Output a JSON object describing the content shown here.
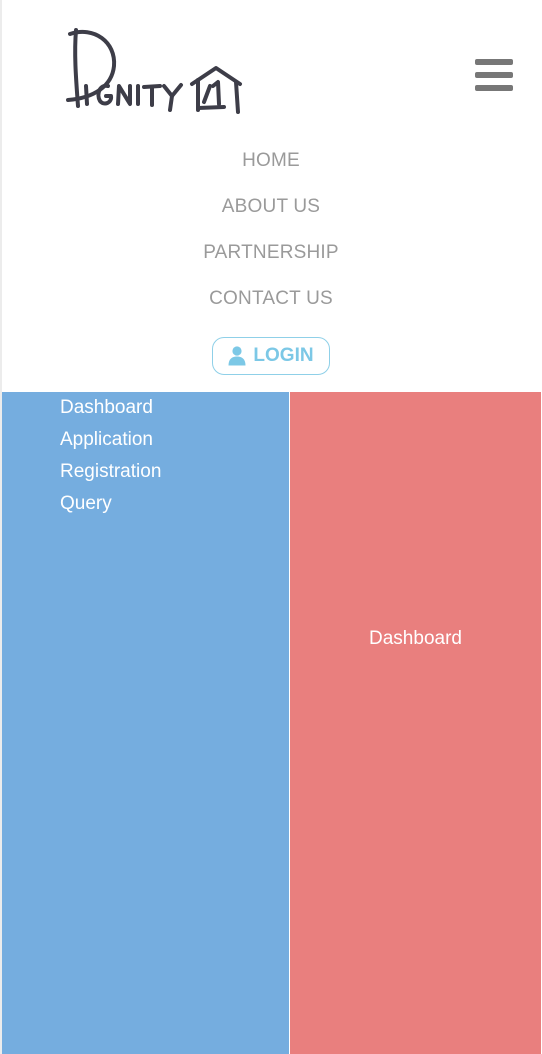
{
  "header": {
    "logo_text": "Dignity"
  },
  "nav": {
    "items": [
      {
        "label": "HOME"
      },
      {
        "label": "ABOUT US"
      },
      {
        "label": "PARTNERSHIP"
      },
      {
        "label": "CONTACT US"
      }
    ],
    "login_label": "LOGIN"
  },
  "sidebar": {
    "items": [
      {
        "label": "Dashboard"
      },
      {
        "label": "Application"
      },
      {
        "label": "Registration"
      },
      {
        "label": "Query"
      }
    ]
  },
  "main": {
    "title": "Dashboard"
  },
  "colors": {
    "sidebar_bg": "#75addf",
    "main_bg": "#e97f7e",
    "nav_text": "#9a9a9a",
    "login_accent": "#7cc8e6",
    "logo_ink": "#3d3d48"
  },
  "icons": {
    "menu": "hamburger-menu-icon",
    "login": "user-icon",
    "logo": "house-logo-icon"
  }
}
